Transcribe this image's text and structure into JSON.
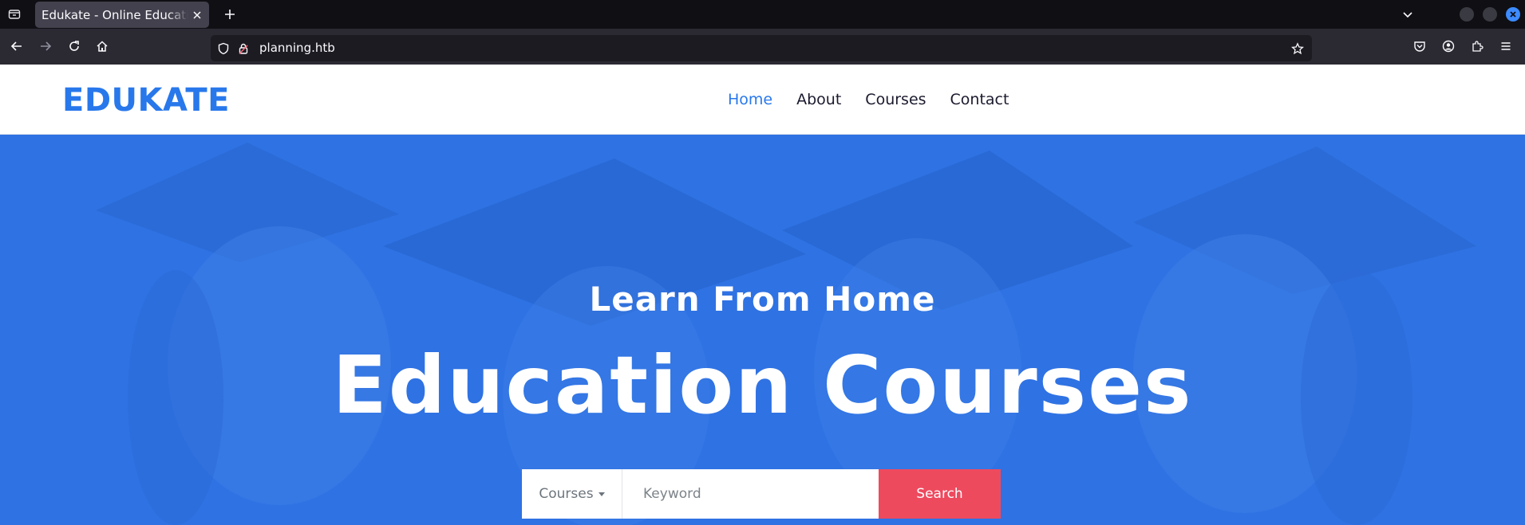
{
  "browser": {
    "tab_title": "Edukate - Online Education Website",
    "url": "planning.htb"
  },
  "site": {
    "brand": "EDUKATE",
    "menu": [
      {
        "label": "Home",
        "active": true
      },
      {
        "label": "About",
        "active": false
      },
      {
        "label": "Courses",
        "active": false
      },
      {
        "label": "Contact",
        "active": false
      }
    ]
  },
  "hero": {
    "subtitle": "Learn From Home",
    "title": "Education Courses",
    "search": {
      "category_label": "Courses",
      "keyword_placeholder": "Keyword",
      "button_label": "Search"
    }
  },
  "colors": {
    "brand": "#2878eb",
    "hero_overlay": "#2f72e3",
    "search_button": "#ee4a5e"
  }
}
